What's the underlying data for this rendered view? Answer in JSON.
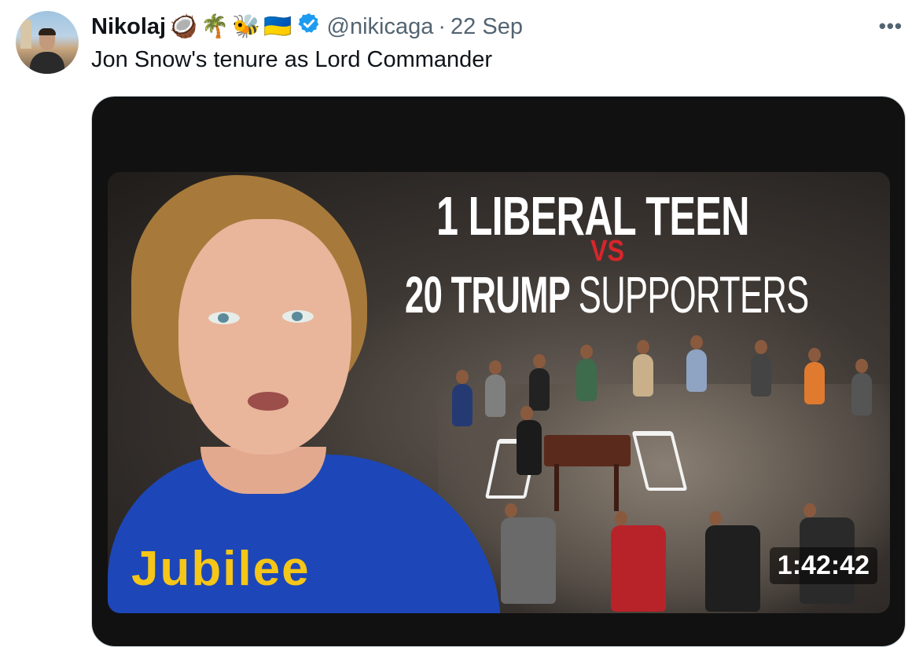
{
  "author": {
    "name": "Nikolaj",
    "emojis": [
      "🥥",
      "🌴",
      "🐝",
      "🇺🇦"
    ],
    "verified": true,
    "handle": "@nikicaga",
    "separator": "·",
    "date": "22 Sep"
  },
  "more_icon": "more-dots-icon",
  "more_label": "•••",
  "tweet": {
    "text": "Jon Snow's tenure as Lord Commander"
  },
  "media": {
    "headline_line1": "1 LIBERAL TEEN",
    "vs": "VS",
    "headline_line2_bold": "20 TRUMP",
    "headline_line2_light": "SUPPORTERS",
    "logo": "Jubilee",
    "duration": "1:42:42"
  },
  "colors": {
    "text_primary": "#0f1419",
    "text_secondary": "#536471",
    "verified_blue": "#1d9bf0",
    "vs_red": "#d7262b",
    "logo_yellow": "#f5c518"
  }
}
